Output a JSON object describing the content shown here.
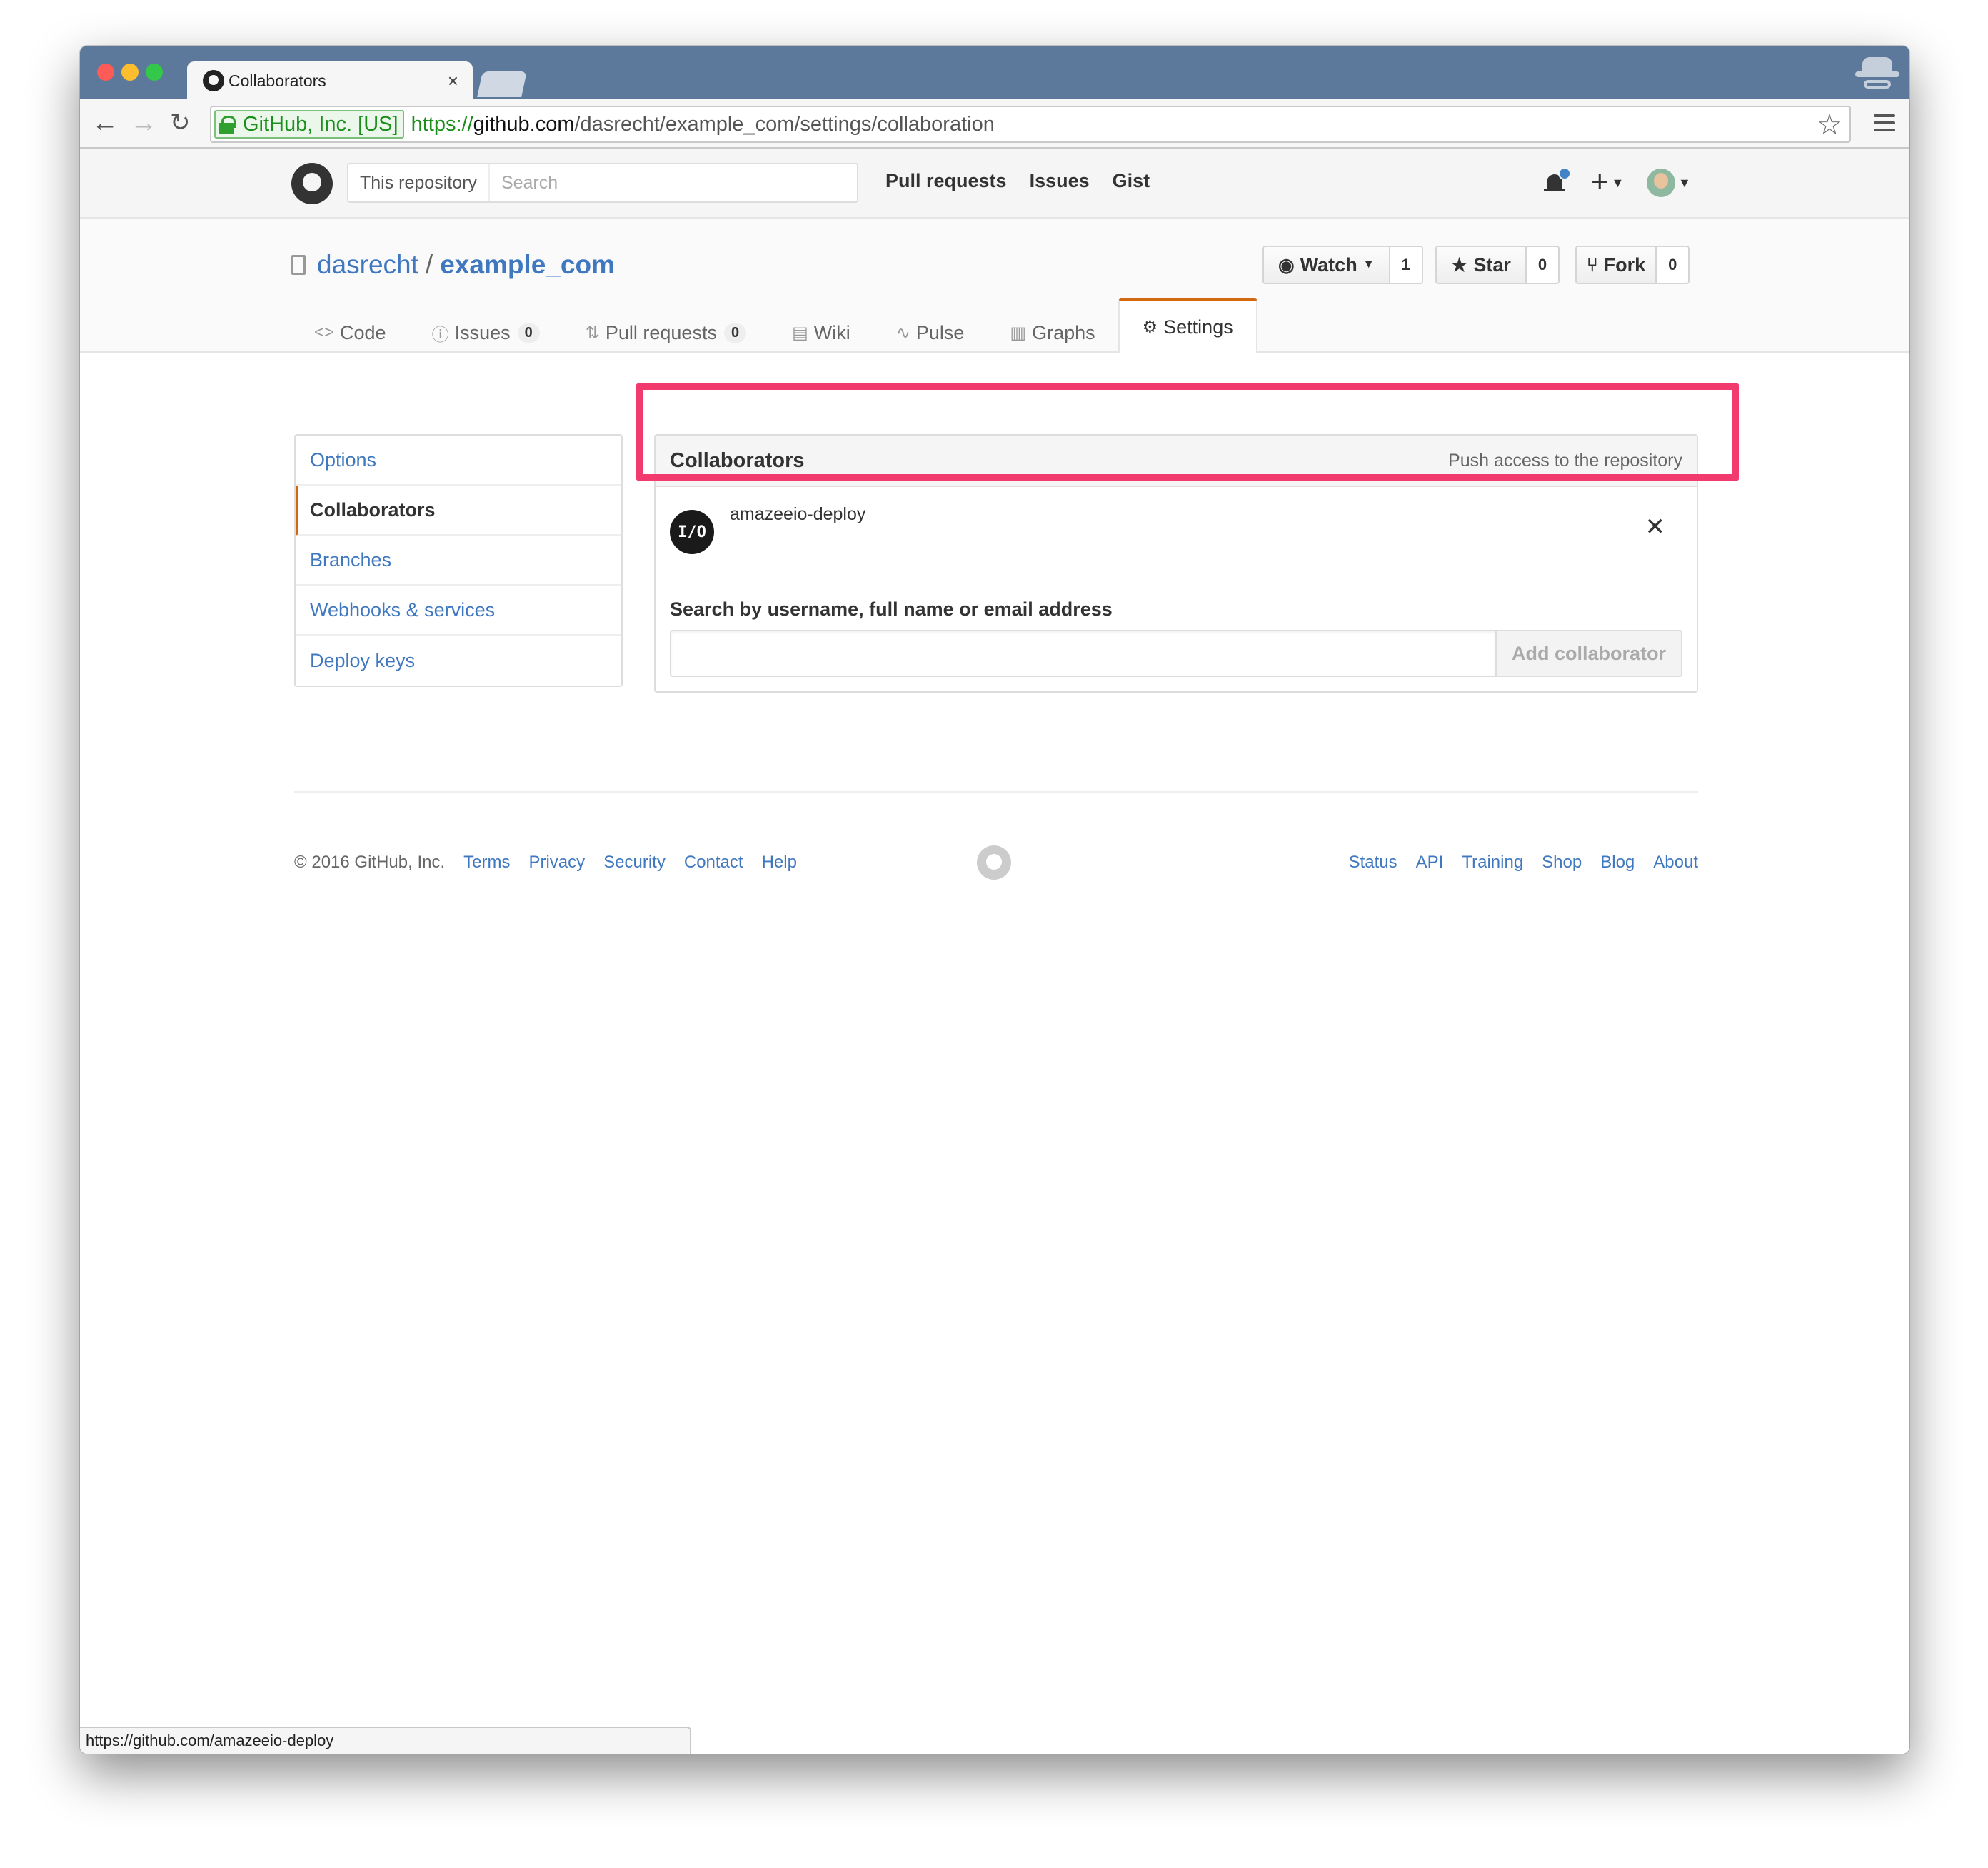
{
  "browser": {
    "tab_title": "Collaborators",
    "tab_close": "×",
    "ev_label": "GitHub, Inc. [US]",
    "url_scheme": "https://",
    "url_host": "github.com",
    "url_path": "/dasrecht/example_com/settings/collaboration",
    "status_url": "https://github.com/amazeeio-deploy"
  },
  "header": {
    "search_scope": "This repository",
    "search_placeholder": "Search",
    "nav": [
      "Pull requests",
      "Issues",
      "Gist"
    ]
  },
  "repo": {
    "owner": "dasrecht",
    "separator": "/",
    "name": "example_com",
    "watch_label": "Watch",
    "watch_count": "1",
    "star_label": "Star",
    "star_count": "0",
    "fork_label": "Fork",
    "fork_count": "0"
  },
  "reponav": {
    "code": "Code",
    "issues": "Issues",
    "issues_count": "0",
    "pulls": "Pull requests",
    "pulls_count": "0",
    "wiki": "Wiki",
    "pulse": "Pulse",
    "graphs": "Graphs",
    "settings": "Settings"
  },
  "sidebar": {
    "items": [
      "Options",
      "Collaborators",
      "Branches",
      "Webhooks & services",
      "Deploy keys"
    ]
  },
  "panel": {
    "title": "Collaborators",
    "note": "Push access to the repository",
    "collaborator_avatar": "I/O",
    "collaborator_name": "amazeeio-deploy",
    "remove": "✕",
    "search_label": "Search by username, full name or email address",
    "add_button": "Add collaborator"
  },
  "footer": {
    "copyright": "© 2016 GitHub, Inc.",
    "left_links": [
      "Terms",
      "Privacy",
      "Security",
      "Contact",
      "Help"
    ],
    "right_links": [
      "Status",
      "API",
      "Training",
      "Shop",
      "Blog",
      "About"
    ]
  },
  "colors": {
    "highlight": "#f33a6e",
    "link": "#4078c0",
    "selected_accent": "#d26911"
  }
}
